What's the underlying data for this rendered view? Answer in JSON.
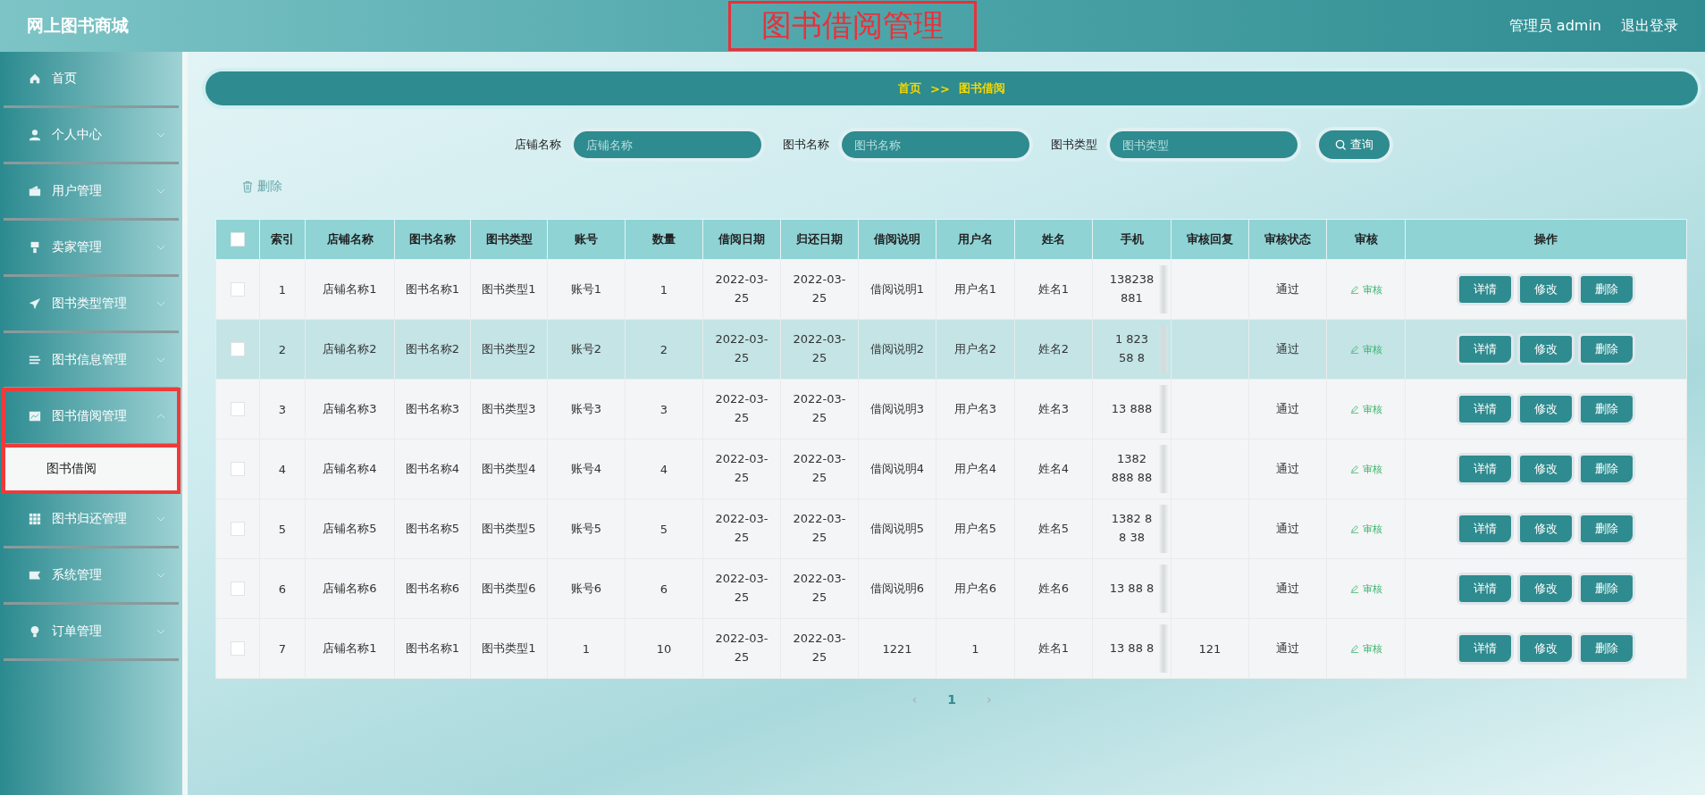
{
  "header": {
    "site_title": "网上图书商城",
    "page_title": "图书借阅管理",
    "user_label": "管理员 admin",
    "logout": "退出登录"
  },
  "sidebar": {
    "items": [
      {
        "label": "首页",
        "kind": "link"
      },
      {
        "label": "个人中心",
        "kind": "group",
        "expanded": false
      },
      {
        "label": "用户管理",
        "kind": "group",
        "expanded": false
      },
      {
        "label": "卖家管理",
        "kind": "group",
        "expanded": false
      },
      {
        "label": "图书类型管理",
        "kind": "group",
        "expanded": false
      },
      {
        "label": "图书信息管理",
        "kind": "group",
        "expanded": false
      },
      {
        "label": "图书借阅管理",
        "kind": "group",
        "expanded": true,
        "highlighted": true,
        "children": [
          {
            "label": "图书借阅",
            "selected": true
          }
        ]
      },
      {
        "label": "图书归还管理",
        "kind": "group",
        "expanded": false
      },
      {
        "label": "系统管理",
        "kind": "group",
        "expanded": false
      },
      {
        "label": "订单管理",
        "kind": "group",
        "expanded": false
      }
    ]
  },
  "breadcrumb": [
    "首页",
    ">>",
    "图书借阅"
  ],
  "search": {
    "fields": [
      {
        "label": "店铺名称",
        "placeholder": "店铺名称"
      },
      {
        "label": "图书名称",
        "placeholder": "图书名称"
      },
      {
        "label": "图书类型",
        "placeholder": "图书类型"
      }
    ],
    "button": "查询"
  },
  "bulk_delete": "删除",
  "table": {
    "columns": [
      "索引",
      "店铺名称",
      "图书名称",
      "图书类型",
      "账号",
      "数量",
      "借阅日期",
      "归还日期",
      "借阅说明",
      "用户名",
      "姓名",
      "手机",
      "审核回复",
      "审核状态",
      "审核",
      "操作"
    ],
    "header_checked": false,
    "rows": [
      {
        "cells": [
          "1",
          "店铺名称1",
          "图书名称1",
          "图书类型1",
          "账号1",
          "1",
          "2022-03-25",
          "2022-03-25",
          "借阅说明1",
          "用户名1",
          "姓名1",
          "138238 881",
          "",
          "通过"
        ],
        "review": "审核",
        "actions": [
          "详情",
          "修改",
          "删除"
        ],
        "checked": false,
        "highlighted": false
      },
      {
        "cells": [
          "2",
          "店铺名称2",
          "图书名称2",
          "图书类型2",
          "账号2",
          "2",
          "2022-03-25",
          "2022-03-25",
          "借阅说明2",
          "用户名2",
          "姓名2",
          "1 823 58 8",
          "",
          "通过"
        ],
        "review": "审核",
        "actions": [
          "详情",
          "修改",
          "删除"
        ],
        "checked": false,
        "highlighted": true
      },
      {
        "cells": [
          "3",
          "店铺名称3",
          "图书名称3",
          "图书类型3",
          "账号3",
          "3",
          "2022-03-25",
          "2022-03-25",
          "借阅说明3",
          "用户名3",
          "姓名3",
          "13 888",
          "",
          "通过"
        ],
        "review": "审核",
        "actions": [
          "详情",
          "修改",
          "删除"
        ],
        "checked": false,
        "highlighted": false
      },
      {
        "cells": [
          "4",
          "店铺名称4",
          "图书名称4",
          "图书类型4",
          "账号4",
          "4",
          "2022-03-25",
          "2022-03-25",
          "借阅说明4",
          "用户名4",
          "姓名4",
          "1382 888 88",
          "",
          "通过"
        ],
        "review": "审核",
        "actions": [
          "详情",
          "修改",
          "删除"
        ],
        "checked": false,
        "highlighted": false
      },
      {
        "cells": [
          "5",
          "店铺名称5",
          "图书名称5",
          "图书类型5",
          "账号5",
          "5",
          "2022-03-25",
          "2022-03-25",
          "借阅说明5",
          "用户名5",
          "姓名5",
          "1382 8 8 38",
          "",
          "通过"
        ],
        "review": "审核",
        "actions": [
          "详情",
          "修改",
          "删除"
        ],
        "checked": false,
        "highlighted": false
      },
      {
        "cells": [
          "6",
          "店铺名称6",
          "图书名称6",
          "图书类型6",
          "账号6",
          "6",
          "2022-03-25",
          "2022-03-25",
          "借阅说明6",
          "用户名6",
          "姓名6",
          "13 88 8",
          "",
          "通过"
        ],
        "review": "审核",
        "actions": [
          "详情",
          "修改",
          "删除"
        ],
        "checked": false,
        "highlighted": false
      },
      {
        "cells": [
          "7",
          "店铺名称1",
          "图书名称1",
          "图书类型1",
          "1",
          "10",
          "2022-03-25",
          "2022-03-25",
          "1221",
          "1",
          "姓名1",
          "13 88 8",
          "121",
          "通过"
        ],
        "review": "审核",
        "actions": [
          "详情",
          "修改",
          "删除"
        ],
        "checked": false,
        "highlighted": false
      }
    ]
  },
  "pagination": {
    "prev": "‹",
    "pages": [
      {
        "label": "1",
        "selected": true
      }
    ],
    "next": "›"
  }
}
